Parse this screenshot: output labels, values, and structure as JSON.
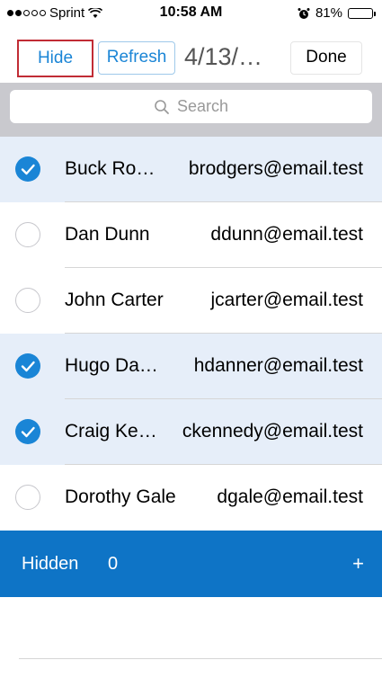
{
  "status_bar": {
    "carrier": "Sprint",
    "time": "10:58 AM",
    "battery": "81%",
    "battery_level": 0.81,
    "icons": [
      "wifi-icon",
      "alarm-icon",
      "battery-icon"
    ]
  },
  "toolbar": {
    "hide_label": "Hide",
    "refresh_label": "Refresh",
    "date_title": "4/13/…",
    "done_label": "Done"
  },
  "search": {
    "placeholder": "Search"
  },
  "contacts": [
    {
      "name": "Buck Ro…",
      "email": "brodgers@email.test",
      "checked": true
    },
    {
      "name": "Dan Dunn",
      "email": "ddunn@email.test",
      "checked": false
    },
    {
      "name": "John Carter",
      "email": "jcarter@email.test",
      "checked": false
    },
    {
      "name": "Hugo Da…",
      "email": "hdanner@email.test",
      "checked": true
    },
    {
      "name": "Craig Ke…",
      "email": "ckennedy@email.test",
      "checked": true
    },
    {
      "name": "Dorothy Gale",
      "email": "dgale@email.test",
      "checked": false
    }
  ],
  "hidden_section": {
    "label": "Hidden",
    "count": "0",
    "plus": "+"
  },
  "colors": {
    "accent": "#1a85d6",
    "hidden_bar": "#0e74c6",
    "selected_row": "#e6eef9",
    "highlight_border": "#c12c35"
  }
}
